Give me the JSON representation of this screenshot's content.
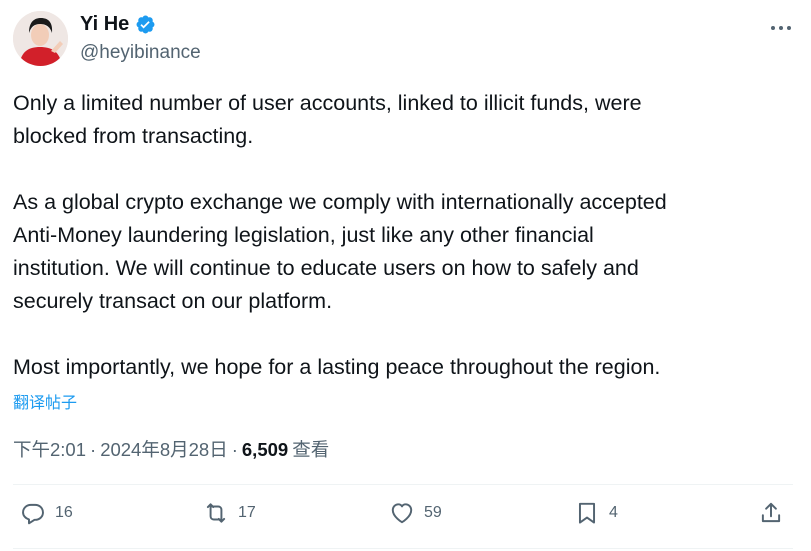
{
  "author": {
    "display_name": "Yi He",
    "handle": "@heyibinance",
    "verified": true,
    "avatar_icon": "profile-photo"
  },
  "tweet": {
    "paragraphs": [
      [
        "Only a limited number of user accounts, linked to illicit funds, were",
        "blocked from transacting."
      ],
      [
        "As a global crypto exchange we comply with internationally accepted",
        "Anti-Money laundering legislation, just like any other financial",
        "institution. We will continue to educate users on how to safely and",
        "securely transact on our platform."
      ],
      [
        "Most importantly, we hope for a lasting peace throughout the region."
      ]
    ],
    "translate_label": "翻译帖子"
  },
  "meta": {
    "time": "下午2:01",
    "separator": "·",
    "date": "2024年8月28日",
    "views_count": "6,509",
    "views_label": "查看"
  },
  "actions": {
    "reply_count": "16",
    "retweet_count": "17",
    "like_count": "59",
    "bookmark_count": "4"
  },
  "colors": {
    "text": "#0f1419",
    "secondary": "#536471",
    "link": "#1d9bf0",
    "divider": "#eff3f4"
  }
}
